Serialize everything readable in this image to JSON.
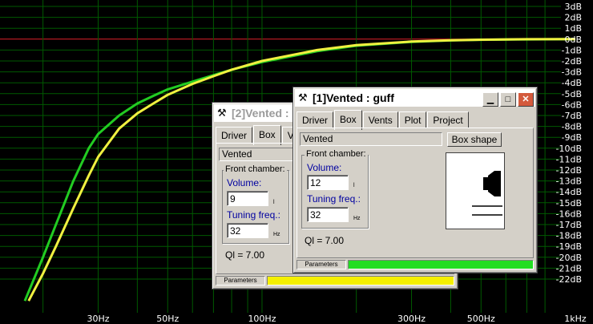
{
  "plot": {
    "background": "#000000",
    "grid_color": "#005a00",
    "zero_line_color": "#e0202a",
    "tick_color": "#ffffff",
    "db_labels": [
      "3dB",
      "2dB",
      "1dB",
      "0dB",
      "-1dB",
      "-2dB",
      "-3dB",
      "-4dB",
      "-5dB",
      "-6dB",
      "-7dB",
      "-8dB",
      "-9dB",
      "-10dB",
      "-11dB",
      "-12dB",
      "-13dB",
      "-14dB",
      "-15dB",
      "-16dB",
      "-17dB",
      "-18dB",
      "-19dB",
      "-20dB",
      "-21dB",
      "-22dB"
    ],
    "db_values": [
      3,
      2,
      1,
      0,
      -1,
      -2,
      -3,
      -4,
      -5,
      -6,
      -7,
      -8,
      -9,
      -10,
      -11,
      -12,
      -13,
      -14,
      -15,
      -16,
      -17,
      -18,
      -19,
      -20,
      -21,
      -22
    ],
    "freq_labels": [
      "30Hz",
      "50Hz",
      "100Hz",
      "300Hz",
      "500Hz",
      "1kHz"
    ],
    "freq_label_values": [
      30,
      50,
      100,
      300,
      500,
      1000
    ],
    "freq_grid": [
      20,
      30,
      40,
      50,
      60,
      70,
      80,
      90,
      100,
      200,
      300,
      400,
      500,
      600,
      700,
      800,
      900,
      1000
    ],
    "curves": [
      {
        "color": "#22cc22",
        "points": [
          [
            17.5,
            -24
          ],
          [
            20,
            -20
          ],
          [
            22,
            -17
          ],
          [
            25,
            -13
          ],
          [
            28,
            -10
          ],
          [
            30,
            -8.7
          ],
          [
            35,
            -7
          ],
          [
            40,
            -5.9
          ],
          [
            45,
            -5.2
          ],
          [
            50,
            -4.6
          ],
          [
            60,
            -3.9
          ],
          [
            70,
            -3.3
          ],
          [
            80,
            -2.8
          ],
          [
            100,
            -2.1
          ],
          [
            150,
            -1.1
          ],
          [
            200,
            -0.6
          ],
          [
            300,
            -0.25
          ],
          [
            400,
            -0.12
          ],
          [
            500,
            -0.06
          ],
          [
            700,
            -0.02
          ],
          [
            1000,
            0
          ]
        ]
      },
      {
        "color": "#f0f040",
        "points": [
          [
            18,
            -24
          ],
          [
            20,
            -21.5
          ],
          [
            22,
            -19
          ],
          [
            25,
            -15.5
          ],
          [
            28,
            -12.5
          ],
          [
            30,
            -10.8
          ],
          [
            35,
            -8.2
          ],
          [
            40,
            -6.8
          ],
          [
            45,
            -5.9
          ],
          [
            50,
            -5.1
          ],
          [
            60,
            -4.1
          ],
          [
            70,
            -3.4
          ],
          [
            80,
            -2.8
          ],
          [
            100,
            -2.0
          ],
          [
            150,
            -1.0
          ],
          [
            200,
            -0.55
          ],
          [
            300,
            -0.22
          ],
          [
            400,
            -0.1
          ],
          [
            500,
            -0.05
          ],
          [
            700,
            -0.01
          ],
          [
            1000,
            0
          ]
        ]
      }
    ]
  },
  "win1": {
    "title": "[1]Vented : guff",
    "tabs": [
      "Driver",
      "Box",
      "Vents",
      "Plot",
      "Project"
    ],
    "box_type": "Vented",
    "box_shape_button": "Box shape",
    "group_title": "Front chamber:",
    "volume_label": "Volume:",
    "volume_value": "12",
    "volume_unit": "l",
    "tuning_label": "Tuning freq.:",
    "tuning_value": "32",
    "tuning_unit": "Hz",
    "ql_text": "Ql = 7.00",
    "status_label": "Parameters",
    "status_color": "#22dd22"
  },
  "win2": {
    "title": "[2]Vented :",
    "tabs": [
      "Driver",
      "Box",
      "V"
    ],
    "box_type": "Vented",
    "group_title": "Front chamber:",
    "volume_label": "Volume:",
    "volume_value": "9",
    "volume_unit": "l",
    "tuning_label": "Tuning freq.:",
    "tuning_value": "32",
    "tuning_unit": "Hz",
    "ql_text": "Ql = 7.00",
    "status_label": "Parameters",
    "status_color": "#f5f000"
  },
  "icons": {
    "app": "wrench-icon",
    "minimize": "minimize-icon",
    "maximize": "maximize-icon",
    "close": "close-icon"
  }
}
